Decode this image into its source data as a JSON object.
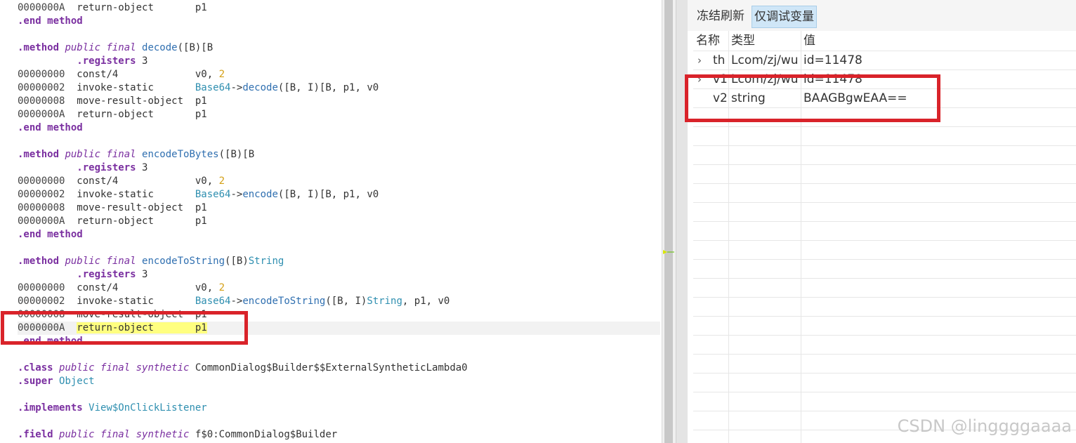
{
  "code_lines": [
    [
      {
        "t": "0000000A  ",
        "c": "addr"
      },
      {
        "t": "return-object       ",
        "c": "op"
      },
      {
        "t": "p1",
        "c": "op"
      }
    ],
    [
      {
        "t": ".end method",
        "c": "kw"
      }
    ],
    [],
    [
      {
        "t": ".method ",
        "c": "kw"
      },
      {
        "t": "public final ",
        "c": "mod"
      },
      {
        "t": "decode",
        "c": "fn"
      },
      {
        "t": "([B)[B",
        "c": "op"
      }
    ],
    [
      {
        "t": "          ",
        "c": "op"
      },
      {
        "t": ".registers ",
        "c": "kw"
      },
      {
        "t": "3",
        "c": "op"
      }
    ],
    [
      {
        "t": "00000000  ",
        "c": "addr"
      },
      {
        "t": "const/4             ",
        "c": "op"
      },
      {
        "t": "v0, ",
        "c": "op"
      },
      {
        "t": "2",
        "c": "num"
      }
    ],
    [
      {
        "t": "00000002  ",
        "c": "addr"
      },
      {
        "t": "invoke-static       ",
        "c": "op"
      },
      {
        "t": "Base64",
        "c": "cls"
      },
      {
        "t": "->",
        "c": "op"
      },
      {
        "t": "decode",
        "c": "fn"
      },
      {
        "t": "([B, I)[B, p1, v0",
        "c": "op"
      }
    ],
    [
      {
        "t": "00000008  ",
        "c": "addr"
      },
      {
        "t": "move-result-object  ",
        "c": "op"
      },
      {
        "t": "p1",
        "c": "op"
      }
    ],
    [
      {
        "t": "0000000A  ",
        "c": "addr"
      },
      {
        "t": "return-object       ",
        "c": "op"
      },
      {
        "t": "p1",
        "c": "op"
      }
    ],
    [
      {
        "t": ".end method",
        "c": "kw"
      }
    ],
    [],
    [
      {
        "t": ".method ",
        "c": "kw"
      },
      {
        "t": "public final ",
        "c": "mod"
      },
      {
        "t": "encodeToBytes",
        "c": "fn"
      },
      {
        "t": "([B)[B",
        "c": "op"
      }
    ],
    [
      {
        "t": "          ",
        "c": "op"
      },
      {
        "t": ".registers ",
        "c": "kw"
      },
      {
        "t": "3",
        "c": "op"
      }
    ],
    [
      {
        "t": "00000000  ",
        "c": "addr"
      },
      {
        "t": "const/4             ",
        "c": "op"
      },
      {
        "t": "v0, ",
        "c": "op"
      },
      {
        "t": "2",
        "c": "num"
      }
    ],
    [
      {
        "t": "00000002  ",
        "c": "addr"
      },
      {
        "t": "invoke-static       ",
        "c": "op"
      },
      {
        "t": "Base64",
        "c": "cls"
      },
      {
        "t": "->",
        "c": "op"
      },
      {
        "t": "encode",
        "c": "fn"
      },
      {
        "t": "([B, I)[B, p1, v0",
        "c": "op"
      }
    ],
    [
      {
        "t": "00000008  ",
        "c": "addr"
      },
      {
        "t": "move-result-object  ",
        "c": "op"
      },
      {
        "t": "p1",
        "c": "op"
      }
    ],
    [
      {
        "t": "0000000A  ",
        "c": "addr"
      },
      {
        "t": "return-object       ",
        "c": "op"
      },
      {
        "t": "p1",
        "c": "op"
      }
    ],
    [
      {
        "t": ".end method",
        "c": "kw"
      }
    ],
    [],
    [
      {
        "t": ".method ",
        "c": "kw"
      },
      {
        "t": "public final ",
        "c": "mod"
      },
      {
        "t": "encodeToString",
        "c": "fn"
      },
      {
        "t": "([B)",
        "c": "op"
      },
      {
        "t": "String",
        "c": "cls"
      }
    ],
    [
      {
        "t": "          ",
        "c": "op"
      },
      {
        "t": ".registers ",
        "c": "kw"
      },
      {
        "t": "3",
        "c": "op"
      }
    ],
    [
      {
        "t": "00000000  ",
        "c": "addr"
      },
      {
        "t": "const/4             ",
        "c": "op"
      },
      {
        "t": "v0, ",
        "c": "op"
      },
      {
        "t": "2",
        "c": "num"
      }
    ],
    [
      {
        "t": "00000002  ",
        "c": "addr"
      },
      {
        "t": "invoke-static       ",
        "c": "op"
      },
      {
        "t": "Base64",
        "c": "cls"
      },
      {
        "t": "->",
        "c": "op"
      },
      {
        "t": "encodeToString",
        "c": "fn"
      },
      {
        "t": "([B, I)",
        "c": "op"
      },
      {
        "t": "String",
        "c": "cls"
      },
      {
        "t": ", p1, v0",
        "c": "op"
      }
    ],
    [
      {
        "t": "00000008  ",
        "c": "addr"
      },
      {
        "t": "move-result-object  ",
        "c": "op"
      },
      {
        "t": "p1",
        "c": "op"
      }
    ],
    [
      {
        "t": "0000000A  ",
        "c": "addr"
      },
      {
        "t": "return-object       ",
        "c": "hl"
      },
      {
        "t": "p1",
        "c": "hl"
      }
    ],
    [
      {
        "t": ".end method",
        "c": "kw"
      }
    ],
    [],
    [
      {
        "t": ".class ",
        "c": "kw"
      },
      {
        "t": "public final synthetic ",
        "c": "mod"
      },
      {
        "t": "CommonDialog$Builder$$ExternalSyntheticLambda0",
        "c": "op"
      }
    ],
    [
      {
        "t": ".super ",
        "c": "kw"
      },
      {
        "t": "Object",
        "c": "cls"
      }
    ],
    [],
    [
      {
        "t": ".implements ",
        "c": "kw"
      },
      {
        "t": "View$OnClickListener",
        "c": "cls"
      }
    ],
    [],
    [
      {
        "t": ".field ",
        "c": "kw"
      },
      {
        "t": "public final synthetic ",
        "c": "mod"
      },
      {
        "t": "f$0",
        "c": "op"
      },
      {
        "t": ":CommonDialog$Builder",
        "c": "op"
      }
    ]
  ],
  "current_line": 24,
  "toolbar": {
    "freeze_refresh_label": "冻结刷新",
    "debug_vars_only_label": "仅调试变量"
  },
  "variables": {
    "headers": {
      "name": "名称",
      "type": "类型",
      "value": "值"
    },
    "rows": [
      {
        "name": "th",
        "type": "Lcom/zj/wu",
        "value": "id=11478",
        "expandable": true
      },
      {
        "name": "v1",
        "type": "Lcom/zj/wu",
        "value": "id=11478",
        "expandable": true
      },
      {
        "name": "v2",
        "type": "string",
        "value": "BAAGBgwEAA==",
        "expandable": false
      }
    ]
  },
  "watermark": "CSDN @linggggaaaa",
  "colors": {
    "annotation": "#d9232a",
    "highlight": "#ffff80",
    "selected_button": "#cfe6f7"
  }
}
